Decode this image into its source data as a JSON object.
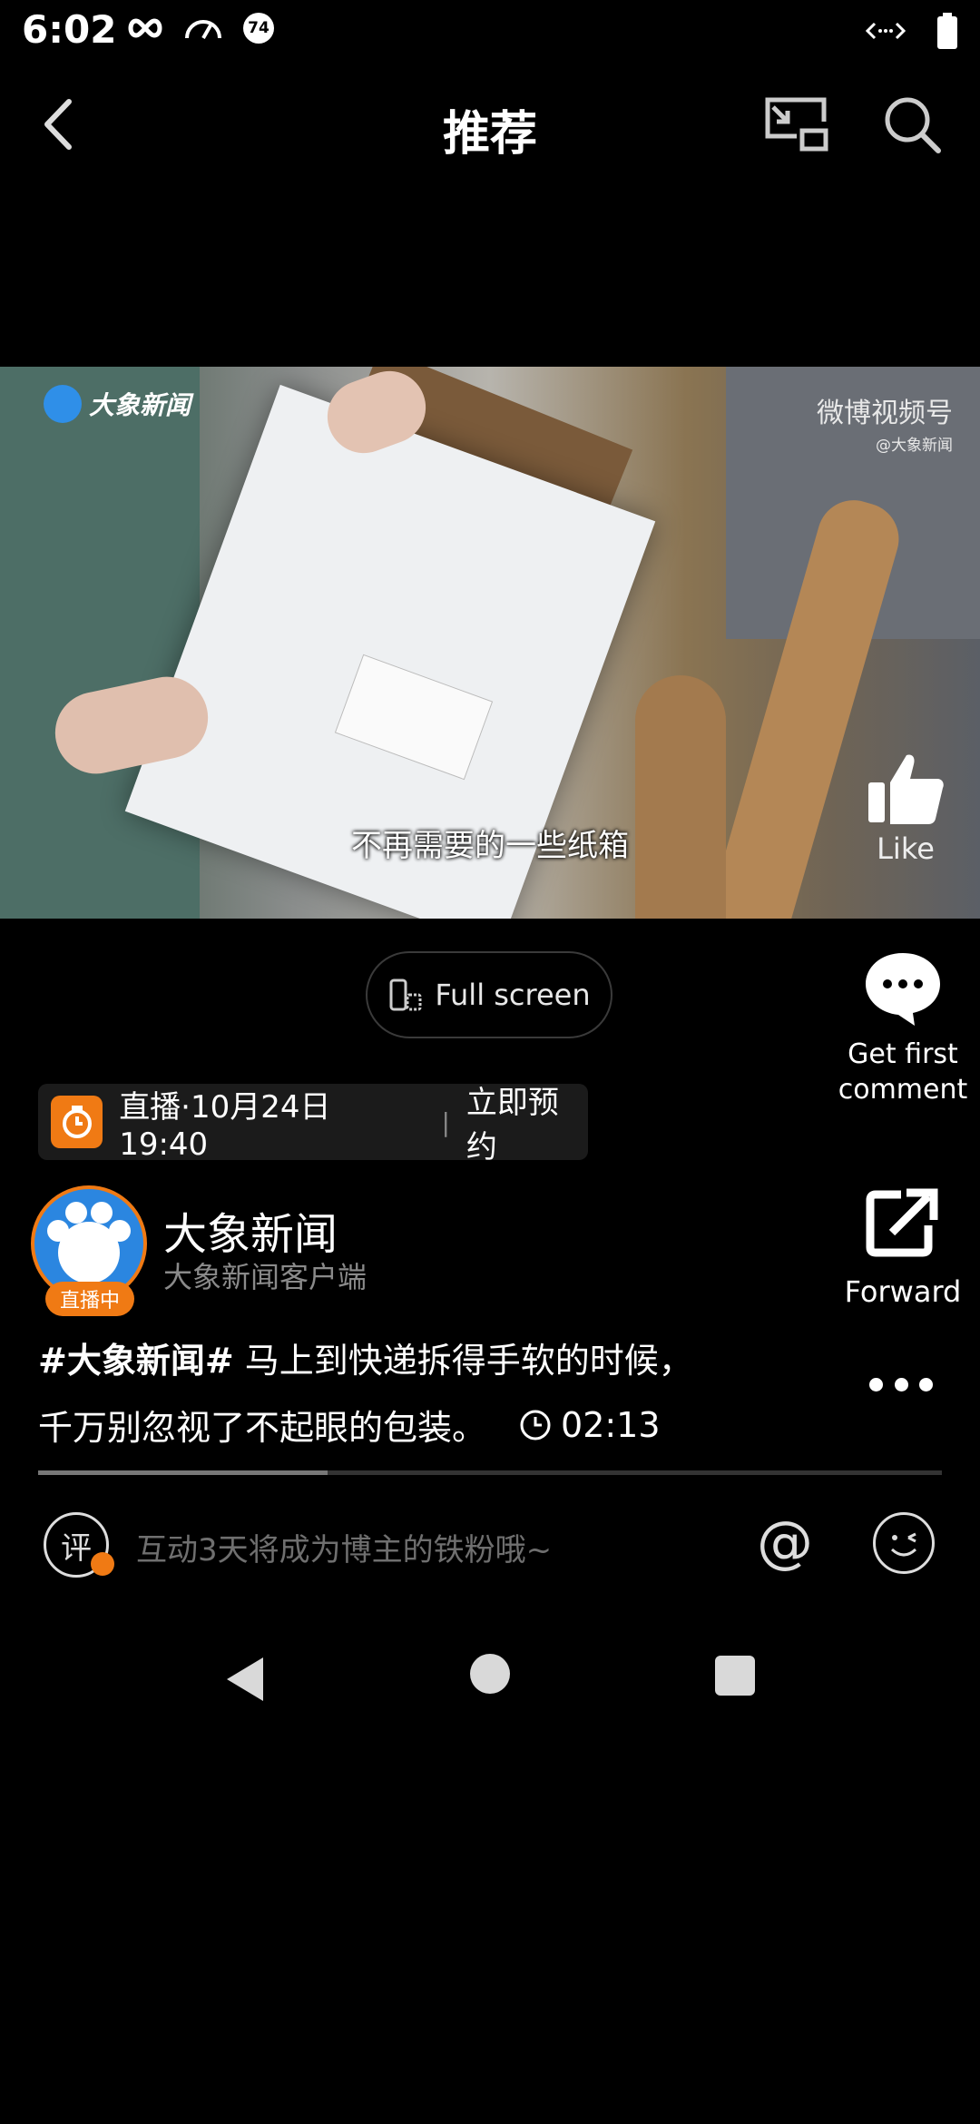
{
  "status_bar": {
    "time": "6:02",
    "badge": "74"
  },
  "header": {
    "title": "推荐"
  },
  "video": {
    "watermark_left": "大象新闻",
    "watermark_right_title": "微博视频号",
    "watermark_right_sub": "@大象新闻",
    "subtitle": "不再需要的一些纸箱"
  },
  "actions": {
    "like_label": "Like",
    "comment_label": "Get first comment",
    "forward_label": "Forward"
  },
  "fullscreen_button": {
    "label": "Full screen"
  },
  "live_banner": {
    "text": "直播·10月24日 19:40",
    "action": "立即预约"
  },
  "author": {
    "name": "大象新闻",
    "subtitle": "大象新闻客户端",
    "live_tag": "直播中"
  },
  "caption": {
    "hashtag": "#大象新闻#",
    "line1": " 马上到快递拆得手软的时候，",
    "line2": "千万别忽视了不起眼的包装。",
    "duration": "02:13"
  },
  "playback": {
    "progress_fraction": 0.32
  },
  "comment_bar": {
    "icon_text": "评",
    "placeholder": "互动3天将成为博主的铁粉哦~",
    "at_symbol": "@"
  }
}
